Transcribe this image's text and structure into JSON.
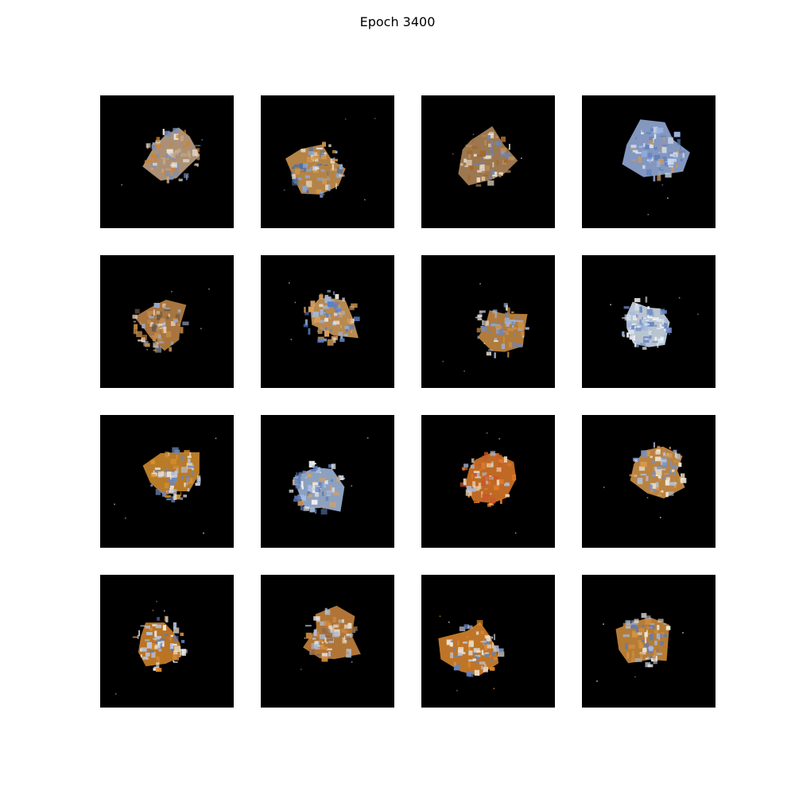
{
  "figure": {
    "title": "Epoch 3400",
    "background_color": "#ffffff",
    "tile_background_color": "#000000"
  },
  "samples": [
    {
      "row": 1,
      "col": 1,
      "palette": [
        "#c9a98a",
        "#7a8fb8",
        "#d2822f",
        "#e8e2da"
      ]
    },
    {
      "row": 1,
      "col": 2,
      "palette": [
        "#d49a52",
        "#8da6cf",
        "#e9dfd2",
        "#4f6fa3"
      ]
    },
    {
      "row": 1,
      "col": 3,
      "palette": [
        "#b98c5d",
        "#6d85b0",
        "#e6d9c6",
        "#a26a2c"
      ]
    },
    {
      "row": 1,
      "col": 4,
      "palette": [
        "#9ab2e0",
        "#d8e4f2",
        "#c79a63",
        "#5e7fbf"
      ]
    },
    {
      "row": 2,
      "col": 1,
      "palette": [
        "#c58a4a",
        "#9aa8c8",
        "#e3d4c0",
        "#6a5a48"
      ]
    },
    {
      "row": 2,
      "col": 2,
      "palette": [
        "#d8a15e",
        "#5a7fc8",
        "#efe6dc",
        "#a0b6d8"
      ]
    },
    {
      "row": 2,
      "col": 3,
      "palette": [
        "#d09045",
        "#9eb0d2",
        "#e9e0d4",
        "#6f86b8"
      ]
    },
    {
      "row": 2,
      "col": 4,
      "palette": [
        "#d9e6f5",
        "#9fb8e0",
        "#f2f2f2",
        "#6c8ac2"
      ]
    },
    {
      "row": 3,
      "col": 1,
      "palette": [
        "#d8902f",
        "#b8c4dc",
        "#ece3d6",
        "#6d86ba"
      ]
    },
    {
      "row": 3,
      "col": 2,
      "palette": [
        "#a6bde0",
        "#d2a068",
        "#eef0f4",
        "#5b79b5"
      ]
    },
    {
      "row": 3,
      "col": 3,
      "palette": [
        "#e07b2a",
        "#a9b9d8",
        "#f0d8b8",
        "#c85a2a"
      ]
    },
    {
      "row": 3,
      "col": 4,
      "palette": [
        "#d99a4e",
        "#b3c0d9",
        "#efe7da",
        "#7b8fb8"
      ]
    },
    {
      "row": 4,
      "col": 1,
      "palette": [
        "#d9882d",
        "#b8c5df",
        "#f1ece4",
        "#5e79b4"
      ]
    },
    {
      "row": 4,
      "col": 2,
      "palette": [
        "#cf8a3f",
        "#b0bad0",
        "#e7ddd0",
        "#8c6a4a"
      ]
    },
    {
      "row": 4,
      "col": 3,
      "palette": [
        "#e0892e",
        "#c2cbe0",
        "#f2e6d5",
        "#6a83b6"
      ]
    },
    {
      "row": 4,
      "col": 4,
      "palette": [
        "#d5923f",
        "#a9b8d6",
        "#ece5dc",
        "#5f7ab5"
      ]
    }
  ]
}
